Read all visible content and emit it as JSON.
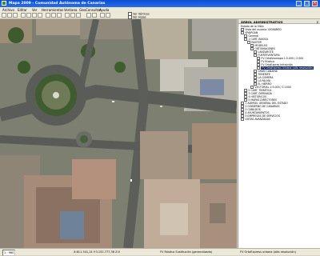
{
  "window": {
    "title": "Mapa 2009 - Comunidad Autónoma de Canarias",
    "minimize": "_",
    "maximize": "□",
    "close": "×"
  },
  "menu": [
    "Archivo",
    "Editar",
    "Ver",
    "Herramientas",
    "Ventana",
    "GeoConsultas",
    "Ayuda"
  ],
  "toolbar": {
    "checks": [
      "Ver Vértices",
      "Ver Hojas"
    ]
  },
  "panel": {
    "title": "ÁRBOL ADMINISTRATIVO",
    "close": "x",
    "items": [
      {
        "label": "Estado de la Vista",
        "indent": 0,
        "cb": false
      },
      {
        "label": "Vista del usuario: SIGNARED",
        "indent": 0,
        "cb": true
      },
      {
        "label": "SPAIPGAN",
        "indent": 0,
        "cb": true
      },
      {
        "label": "General",
        "indent": 1,
        "cb": true
      },
      {
        "label": "1 CART. BASICA",
        "indent": 1,
        "cb": true
      },
      {
        "label": "RASTER",
        "indent": 2,
        "cb": true
      },
      {
        "label": "MODELOS",
        "indent": 3,
        "cb": true
      },
      {
        "label": "ORTOIMAGENES",
        "indent": 3,
        "cb": true
      },
      {
        "label": "LANZAROTE",
        "indent": 4,
        "cb": true
      },
      {
        "label": "FUERTEVENTURA",
        "indent": 4,
        "cb": true
      },
      {
        "label": "FV Ortofotomapa 1:5.000 / 2.000",
        "indent": 5,
        "cb": true
      },
      {
        "label": "FV Rústica",
        "indent": 5,
        "cb": true
      },
      {
        "label": "FV OrtoExpres Infracción",
        "indent": 5,
        "cb": true
      },
      {
        "label": "FV OrtoExpress Urbana (alta resolución)",
        "indent": 5,
        "cb": true,
        "selected": true
      },
      {
        "label": "GRAN CANARIA",
        "indent": 4,
        "cb": true
      },
      {
        "label": "TENERIFE",
        "indent": 4,
        "cb": true
      },
      {
        "label": "LA GOMERA",
        "indent": 4,
        "cb": true
      },
      {
        "label": "LA PALMA",
        "indent": 4,
        "cb": true
      },
      {
        "label": "EL HIERRO",
        "indent": 4,
        "cb": true
      },
      {
        "label": "VECTORIAL 1:5.000 / 1:1000",
        "indent": 3,
        "cb": true
      },
      {
        "label": "2 CART. TEMÁTICA",
        "indent": 1,
        "cb": true
      },
      {
        "label": "3 CART. DERIVADA",
        "indent": 1,
        "cb": true
      },
      {
        "label": "4 HISTÓRICOS",
        "indent": 1,
        "cb": true
      },
      {
        "label": "5 MAPAS DIRECTORES",
        "indent": 1,
        "cb": true
      },
      {
        "label": "1 ADMÓN. GENERAL DEL ESTADO",
        "indent": 0,
        "cb": true
      },
      {
        "label": "2 GOBIERNO DE CANARIAS",
        "indent": 0,
        "cb": true
      },
      {
        "label": "3 CABILDOS",
        "indent": 0,
        "cb": true
      },
      {
        "label": "4 AYUNTAMIENTOS",
        "indent": 0,
        "cb": true
      },
      {
        "label": "5 EMPRESAS DE SERVICIOS",
        "indent": 0,
        "cb": true
      },
      {
        "label": "VISTAS AVANZADAS",
        "indent": 0,
        "cb": true
      }
    ]
  },
  "status": {
    "scale_label": "1 : 960",
    "coords": "X:611.341,14 Y:3.152.777,38 Z:0",
    "layer_a": "FV Rústica Sustitución (generalizado)",
    "layer_b": "FV OrtoExpress urbana (alta resolución)"
  }
}
